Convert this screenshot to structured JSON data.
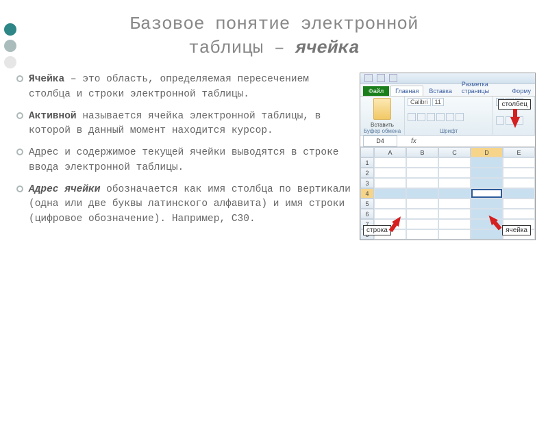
{
  "title_line1": "Базовое понятие электронной",
  "title_line2_a": "таблицы – ",
  "title_line2_b": "ячейка",
  "bullets": [
    {
      "bold": "Ячейка",
      "rest": " – это область, определяемая пересечением столбца и строки электронной таблицы."
    },
    {
      "bold": "Активной",
      "rest": " называется ячейка электронной таблицы, в которой в данный момент находится курсор."
    },
    {
      "plain": "Адрес и содержимое текущей ячейки выводятся в строке ввода электронной таблицы."
    },
    {
      "bold_it": "Адрес ячейки",
      "rest": " обозначается как имя столбца по вертикали (одна или две буквы латинского алфавита) и имя строки (цифровое обозначение). Например, С30."
    }
  ],
  "excel": {
    "file_tab": "Файл",
    "tabs": [
      "Главная",
      "Вставка",
      "Разметка страницы",
      "Форму"
    ],
    "group_clipboard": "Буфер обмена",
    "group_font": "Шрифт",
    "paste_label": "Вставить",
    "font_name": "Calibri",
    "font_size": "11",
    "namebox": "D4",
    "fx": "fx",
    "cols": [
      "A",
      "B",
      "C",
      "D",
      "E"
    ],
    "rows": [
      "1",
      "2",
      "3",
      "4",
      "5",
      "6",
      "7",
      "8"
    ],
    "highlight_col_index": 3,
    "highlight_row_index": 3,
    "callout_column": "столбец",
    "callout_row": "строка",
    "callout_cell": "ячейка"
  }
}
